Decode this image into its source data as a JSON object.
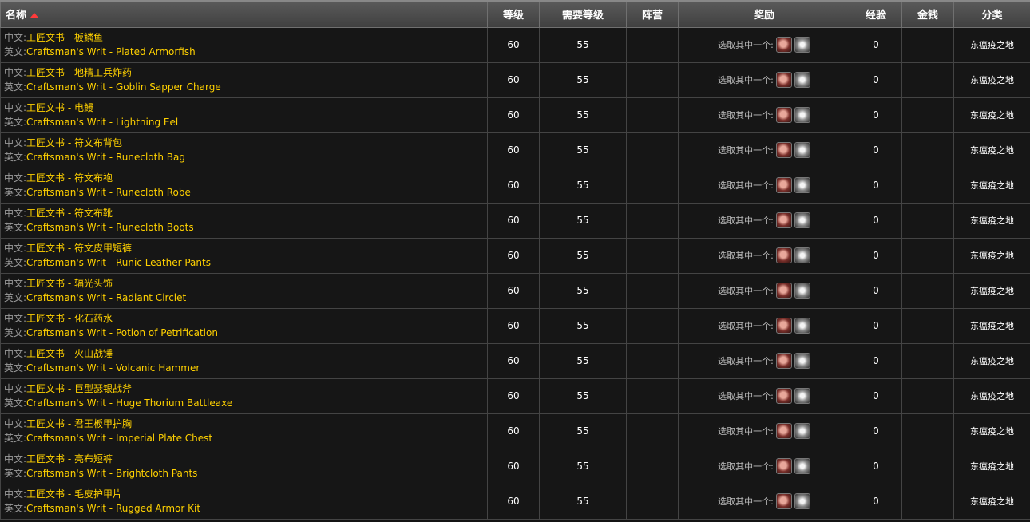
{
  "headers": {
    "name": "名称",
    "level": "等级",
    "req_level": "需要等级",
    "faction": "阵营",
    "reward": "奖励",
    "xp": "经验",
    "money": "金钱",
    "category": "分类"
  },
  "labels": {
    "zh": "中文:",
    "en": "英文:",
    "reward_choose": "选取其中一个:"
  },
  "icons": {
    "sort": "sort-ascending-icon",
    "reward_a": "bag-icon",
    "reward_b": "gem-icon"
  },
  "colors": {
    "quest_name": "#ffd100",
    "sort_arrow": "#ff3a3a"
  },
  "rows": [
    {
      "zh": "工匠文书 - 板鳞鱼",
      "en": "Craftsman's Writ - Plated Armorfish",
      "level": "60",
      "req": "55",
      "faction": "",
      "xp": "0",
      "money": "",
      "category": "东瘟疫之地"
    },
    {
      "zh": "工匠文书 - 地精工兵炸药",
      "en": "Craftsman's Writ - Goblin Sapper Charge",
      "level": "60",
      "req": "55",
      "faction": "",
      "xp": "0",
      "money": "",
      "category": "东瘟疫之地"
    },
    {
      "zh": "工匠文书 - 电鳗",
      "en": "Craftsman's Writ - Lightning Eel",
      "level": "60",
      "req": "55",
      "faction": "",
      "xp": "0",
      "money": "",
      "category": "东瘟疫之地"
    },
    {
      "zh": "工匠文书 - 符文布背包",
      "en": "Craftsman's Writ - Runecloth Bag",
      "level": "60",
      "req": "55",
      "faction": "",
      "xp": "0",
      "money": "",
      "category": "东瘟疫之地"
    },
    {
      "zh": "工匠文书 - 符文布袍",
      "en": "Craftsman's Writ - Runecloth Robe",
      "level": "60",
      "req": "55",
      "faction": "",
      "xp": "0",
      "money": "",
      "category": "东瘟疫之地"
    },
    {
      "zh": "工匠文书 - 符文布靴",
      "en": "Craftsman's Writ - Runecloth Boots",
      "level": "60",
      "req": "55",
      "faction": "",
      "xp": "0",
      "money": "",
      "category": "东瘟疫之地"
    },
    {
      "zh": "工匠文书 - 符文皮甲短裤",
      "en": "Craftsman's Writ - Runic Leather Pants",
      "level": "60",
      "req": "55",
      "faction": "",
      "xp": "0",
      "money": "",
      "category": "东瘟疫之地"
    },
    {
      "zh": "工匠文书 - 辐光头饰",
      "en": "Craftsman's Writ - Radiant Circlet",
      "level": "60",
      "req": "55",
      "faction": "",
      "xp": "0",
      "money": "",
      "category": "东瘟疫之地"
    },
    {
      "zh": "工匠文书 - 化石药水",
      "en": "Craftsman's Writ - Potion of Petrification",
      "level": "60",
      "req": "55",
      "faction": "",
      "xp": "0",
      "money": "",
      "category": "东瘟疫之地"
    },
    {
      "zh": "工匠文书 - 火山战锤",
      "en": "Craftsman's Writ - Volcanic Hammer",
      "level": "60",
      "req": "55",
      "faction": "",
      "xp": "0",
      "money": "",
      "category": "东瘟疫之地"
    },
    {
      "zh": "工匠文书 - 巨型瑟银战斧",
      "en": "Craftsman's Writ - Huge Thorium Battleaxe",
      "level": "60",
      "req": "55",
      "faction": "",
      "xp": "0",
      "money": "",
      "category": "东瘟疫之地"
    },
    {
      "zh": "工匠文书 - 君王板甲护胸",
      "en": "Craftsman's Writ - Imperial Plate Chest",
      "level": "60",
      "req": "55",
      "faction": "",
      "xp": "0",
      "money": "",
      "category": "东瘟疫之地"
    },
    {
      "zh": "工匠文书 - 亮布短裤",
      "en": "Craftsman's Writ - Brightcloth Pants",
      "level": "60",
      "req": "55",
      "faction": "",
      "xp": "0",
      "money": "",
      "category": "东瘟疫之地"
    },
    {
      "zh": "工匠文书 - 毛皮护甲片",
      "en": "Craftsman's Writ - Rugged Armor Kit",
      "level": "60",
      "req": "55",
      "faction": "",
      "xp": "0",
      "money": "",
      "category": "东瘟疫之地"
    }
  ]
}
